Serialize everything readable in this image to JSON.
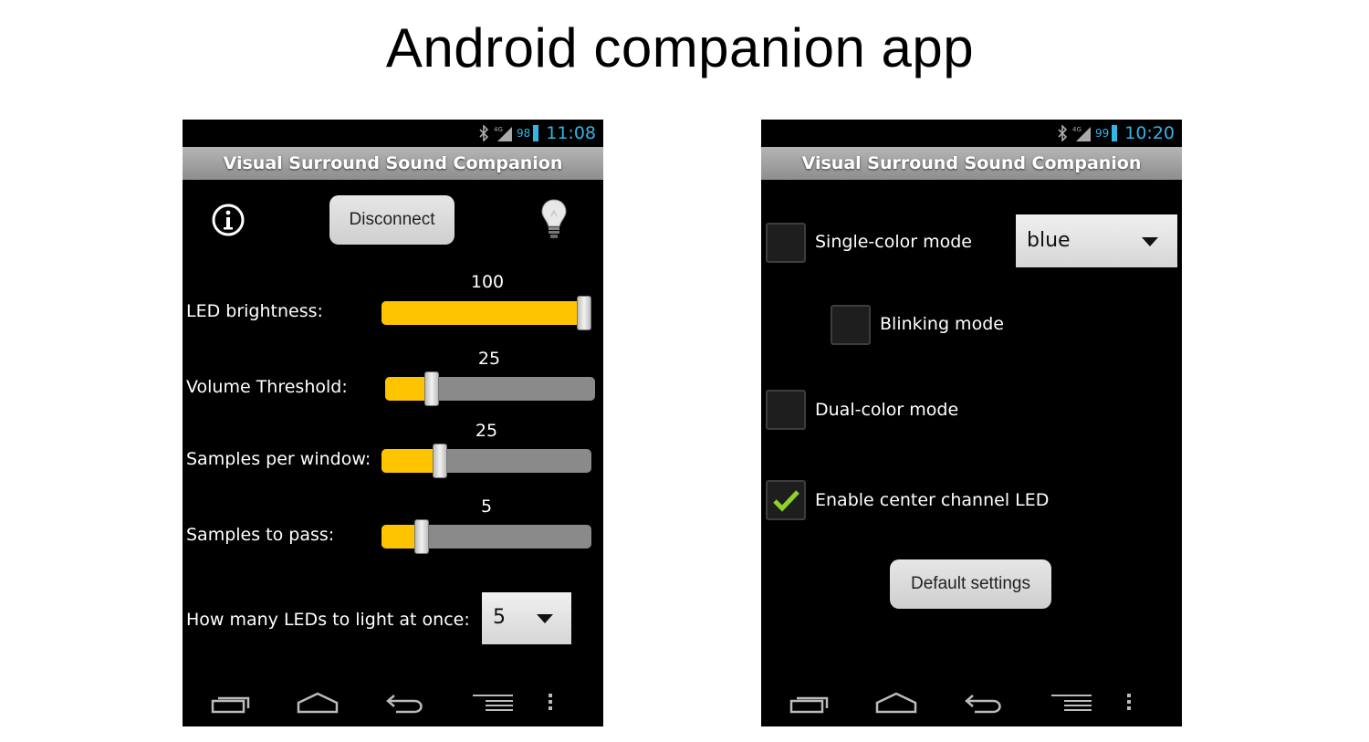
{
  "slide": {
    "title": "Android companion app"
  },
  "left": {
    "status": {
      "battery": "98",
      "time": "11:08",
      "network": "4G"
    },
    "app_title": "Visual Surround Sound Companion",
    "disconnect_label": "Disconnect",
    "sliders": [
      {
        "label": "LED brightness:",
        "value": "100",
        "fraction": 1.0
      },
      {
        "label": "Volume Threshold:",
        "value": "25",
        "fraction": 0.2
      },
      {
        "label": "Samples per window:",
        "value": "25",
        "fraction": 0.26
      },
      {
        "label": "Samples to pass:",
        "value": "5",
        "fraction": 0.17
      }
    ],
    "leds_label": "How many LEDs to light at once:",
    "leds_value": "5"
  },
  "right": {
    "status": {
      "battery": "99",
      "time": "10:20",
      "network": "4G"
    },
    "app_title": "Visual Surround Sound Companion",
    "single_color_label": "Single-color mode",
    "single_color_checked": false,
    "color_value": "blue",
    "blinking_label": "Blinking mode",
    "blinking_checked": false,
    "dual_color_label": "Dual-color mode",
    "dual_color_checked": false,
    "center_led_label": "Enable center channel LED",
    "center_led_checked": true,
    "default_settings_label": "Default settings"
  },
  "colors": {
    "accent": "#ffc400",
    "status_blue": "#33b5e5",
    "check_green": "#8fd22a"
  },
  "icons": [
    "bluetooth-icon",
    "signal-icon",
    "battery-icon",
    "info-icon",
    "lightbulb-icon",
    "recent-apps-icon",
    "home-icon",
    "back-icon",
    "menu-icon",
    "overflow-icon",
    "checkmark-icon",
    "dropdown-arrow-icon"
  ]
}
